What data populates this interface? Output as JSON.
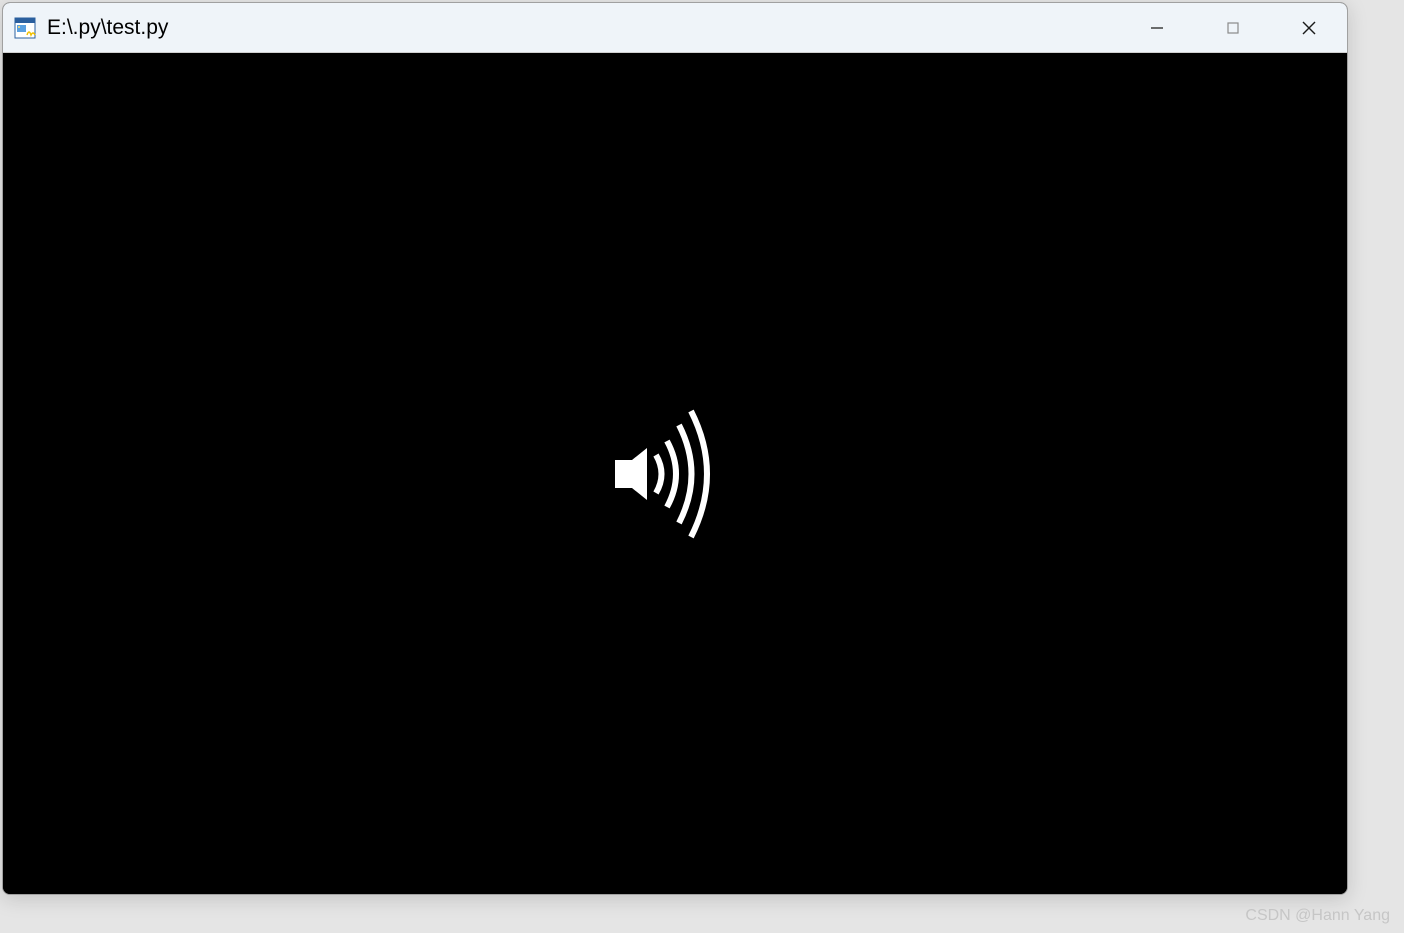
{
  "window": {
    "title": "E:\\.py\\test.py"
  },
  "watermark": {
    "text": "CSDN @Hann Yang"
  }
}
